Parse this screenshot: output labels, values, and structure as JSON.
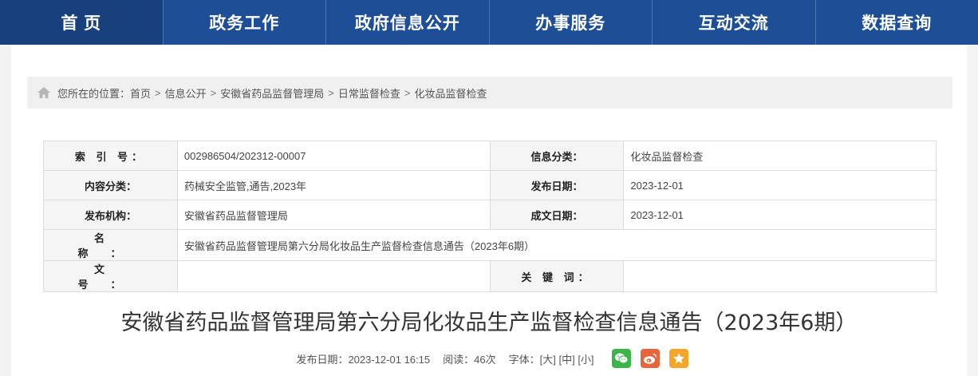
{
  "nav": [
    "首  页",
    "政务工作",
    "政府信息公开",
    "办事服务",
    "互动交流",
    "数据查询"
  ],
  "breadcrumb": {
    "prefix": "您所在的位置：",
    "items": [
      "首页",
      "信息公开",
      "安徽省药品监督管理局",
      "日常监督检查",
      "化妆品监督检查"
    ],
    "separator": ">"
  },
  "meta": {
    "index_label": "索 引 号：",
    "index_value": "002986504/202312-00007",
    "info_class_label": "信息分类：",
    "info_class_value": "化妆品监督检查",
    "content_class_label": "内容分类：",
    "content_class_value": "药械安全监管,通告,2023年",
    "publish_date_label": "发布日期：",
    "publish_date_value": "2023-12-01",
    "agency_label": "发布机构：",
    "agency_value": "安徽省药品监督管理局",
    "doc_date_label": "成文日期：",
    "doc_date_value": "2023-12-01",
    "name_label": "名  称：",
    "name_value": "安徽省药品监督管理局第六分局化妆品生产监督检查信息通告（2023年6期）",
    "docno_label": "文  号：",
    "docno_value": "",
    "keywords_label": "关 键 词：",
    "keywords_value": ""
  },
  "article": {
    "title": "安徽省药品监督管理局第六分局化妆品生产监督检查信息通告（2023年6期）",
    "publish": "发布日期：2023-12-01 16:15",
    "reads": "阅读：46次",
    "font_label": "字体：",
    "font_large": "[大]",
    "font_medium": "[中]",
    "font_small": "[小]"
  },
  "share": {
    "icons": [
      "wechat-icon",
      "weibo-icon",
      "favorite-icon"
    ],
    "colors": {
      "wechat": "#3bb54a",
      "weibo": "#e6653d",
      "favorite": "#f6a52b"
    }
  },
  "colors": {
    "nav_bg": "#1e4f96",
    "page_bg": "#f3f3f3"
  }
}
